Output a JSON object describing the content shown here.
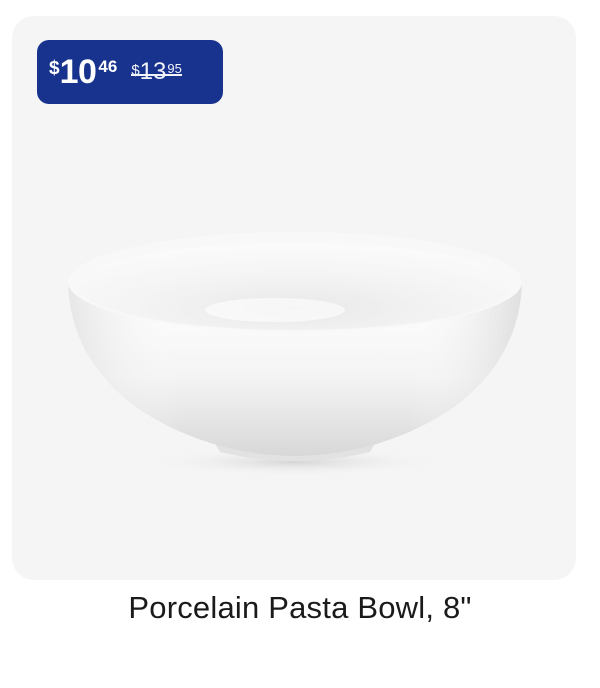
{
  "product": {
    "title": "Porcelain Pasta Bowl, 8\"",
    "image_alt": "white porcelain pasta bowl",
    "sale_price": {
      "currency": "$",
      "dollars": "10",
      "cents": "46"
    },
    "original_price": {
      "currency": "$",
      "dollars": "13",
      "cents": "95"
    }
  },
  "colors": {
    "badge_bg": "#18338e",
    "panel_bg": "#f5f5f6",
    "title_text": "#1a1a1a"
  }
}
